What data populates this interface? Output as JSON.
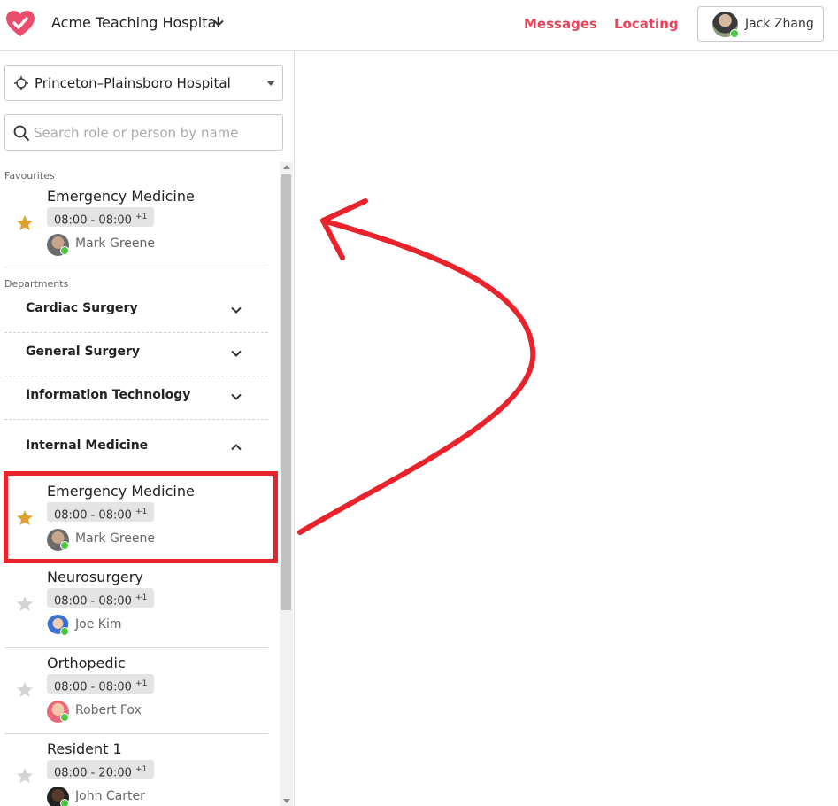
{
  "header": {
    "hospital_title": "Acme Teaching Hospital",
    "nav": {
      "messages": "Messages",
      "locating": "Locating"
    },
    "user": {
      "name": "Jack Zhang"
    }
  },
  "sidebar": {
    "location_select": {
      "value": "Princeton–Plainsboro Hospital"
    },
    "search": {
      "placeholder": "Search role or person by name"
    },
    "favourites_label": "Favourites",
    "departments_label": "Departments",
    "favourites": [
      {
        "role": "Emergency Medicine",
        "shift": "08:00 - 08:00",
        "shift_suffix": "+1",
        "person": "Mark Greene",
        "starred": true
      }
    ],
    "departments": [
      {
        "name": "Cardiac Surgery",
        "expanded": false
      },
      {
        "name": "General Surgery",
        "expanded": false
      },
      {
        "name": "Information Technology",
        "expanded": false
      },
      {
        "name": "Internal Medicine",
        "expanded": true
      }
    ],
    "internal_medicine_roles": [
      {
        "role": "Emergency Medicine",
        "shift": "08:00 - 08:00",
        "shift_suffix": "+1",
        "person": "Mark Greene",
        "starred": true
      },
      {
        "role": "Neurosurgery",
        "shift": "08:00 - 08:00",
        "shift_suffix": "+1",
        "person": "Joe Kim",
        "starred": false
      },
      {
        "role": "Orthopedic",
        "shift": "08:00 - 08:00",
        "shift_suffix": "+1",
        "person": "Robert Fox",
        "starred": false
      },
      {
        "role": "Resident 1",
        "shift": "08:00 - 20:00",
        "shift_suffix": "+1",
        "person": "John Carter",
        "starred": false
      }
    ]
  },
  "colors": {
    "accent": "#e8425a",
    "star_active": "#e0a030",
    "star_inactive": "#c8c8c8",
    "online": "#4cc742",
    "annotation": "#e8232c"
  }
}
